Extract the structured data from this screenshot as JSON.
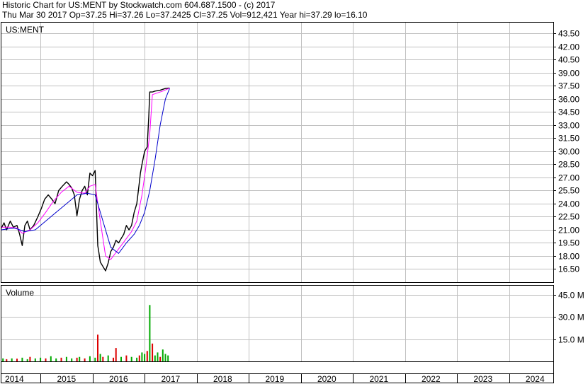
{
  "header": {
    "title_line": "Historic Chart for US:MENT by Stockwatch.com 604.687.1500 - (c) 2017",
    "quote_line": "Thu Mar 30 2017  Op=37.25  Hi=37.26  Lo=37.2425  Cl=37.25  Vol=912,421  Year hi=37.29  lo=16.10"
  },
  "colors": {
    "grid": "#c0c0c0",
    "price_bar": "#000000",
    "ma_short": "#ff00ff",
    "ma_long": "#0000cc",
    "volume_up": "#00aa00",
    "volume_down": "#dd0000"
  },
  "chart_data": [
    {
      "type": "line",
      "title": "US:MENT",
      "y_axis_position": "right",
      "grid": true,
      "y_ticks": [
        "43.50",
        "42.00",
        "40.50",
        "39.00",
        "37.50",
        "36.00",
        "34.50",
        "33.00",
        "31.50",
        "30.00",
        "28.50",
        "27.00",
        "25.50",
        "24.00",
        "22.50",
        "21.00",
        "19.50",
        "18.00",
        "16.50"
      ],
      "ylim": [
        15.0,
        44.75
      ],
      "x_ticks": [
        "2014",
        "2015",
        "2016",
        "2017",
        "2018",
        "2019",
        "2020",
        "2021",
        "2022",
        "2023",
        "2024"
      ],
      "xlim": [
        2013.75,
        2024.35
      ],
      "series": [
        {
          "role": "price",
          "x": [
            2013.75,
            2013.8,
            2013.85,
            2013.92,
            2013.98,
            2014.05,
            2014.1,
            2014.15,
            2014.2,
            2014.25,
            2014.3,
            2014.37,
            2014.45,
            2014.52,
            2014.58,
            2014.65,
            2014.72,
            2014.78,
            2014.85,
            2014.92,
            2015.0,
            2015.05,
            2015.1,
            2015.15,
            2015.2,
            2015.25,
            2015.3,
            2015.35,
            2015.4,
            2015.45,
            2015.5,
            2015.55,
            2015.6,
            2015.62,
            2015.65,
            2015.7,
            2015.75,
            2015.8,
            2015.85,
            2015.9,
            2015.95,
            2016.0,
            2016.05,
            2016.1,
            2016.15,
            2016.2,
            2016.25,
            2016.3,
            2016.35,
            2016.4,
            2016.42,
            2016.45,
            2016.5,
            2016.55,
            2016.58,
            2016.6,
            2016.65,
            2016.7,
            2016.8,
            2016.9,
            2016.98
          ],
          "y": [
            21.2,
            21.8,
            21.0,
            22.0,
            21.3,
            21.5,
            20.5,
            19.2,
            21.5,
            22.0,
            21.0,
            21.5,
            22.5,
            23.5,
            24.5,
            25.0,
            24.5,
            24.0,
            25.5,
            26.0,
            26.5,
            26.2,
            25.8,
            25.0,
            22.6,
            24.5,
            25.5,
            26.0,
            25.0,
            27.5,
            27.2,
            27.8,
            19.2,
            18.5,
            17.3,
            16.8,
            16.3,
            17.2,
            18.5,
            19.0,
            19.8,
            19.5,
            20.0,
            20.5,
            21.5,
            21.0,
            21.5,
            23.0,
            24.0,
            26.5,
            27.5,
            28.5,
            30.0,
            30.5,
            34.0,
            36.8,
            36.8,
            36.9,
            37.0,
            37.2,
            37.25
          ]
        },
        {
          "role": "short moving average",
          "x": [
            2013.75,
            2013.9,
            2014.05,
            2014.15,
            2014.3,
            2014.45,
            2014.6,
            2014.75,
            2014.9,
            2015.05,
            2015.2,
            2015.35,
            2015.45,
            2015.55,
            2015.65,
            2015.75,
            2015.85,
            2016.0,
            2016.15,
            2016.25,
            2016.35,
            2016.45,
            2016.52,
            2016.6,
            2016.65,
            2016.75,
            2016.85,
            2016.98
          ],
          "y": [
            21.3,
            21.3,
            21.2,
            20.6,
            21.0,
            21.8,
            23.0,
            24.3,
            25.3,
            26.0,
            25.3,
            25.2,
            26.0,
            26.2,
            22.0,
            18.0,
            17.6,
            18.8,
            20.0,
            20.8,
            22.0,
            25.0,
            28.0,
            32.0,
            36.5,
            36.7,
            36.9,
            37.25
          ]
        },
        {
          "role": "long moving average",
          "x": [
            2013.75,
            2014.0,
            2014.2,
            2014.4,
            2014.6,
            2014.8,
            2015.0,
            2015.2,
            2015.4,
            2015.55,
            2015.7,
            2015.85,
            2016.0,
            2016.15,
            2016.3,
            2016.4,
            2016.5,
            2016.6,
            2016.7,
            2016.8,
            2016.9,
            2016.98
          ],
          "y": [
            21.0,
            21.2,
            20.8,
            21.0,
            22.0,
            23.0,
            24.0,
            25.0,
            25.2,
            25.0,
            22.0,
            19.0,
            18.3,
            19.5,
            20.5,
            21.5,
            23.0,
            25.5,
            29.0,
            33.0,
            36.0,
            37.2
          ]
        }
      ]
    },
    {
      "type": "bar",
      "title": "Volume",
      "y_axis_position": "right",
      "grid": true,
      "y_ticks": [
        "45.0 M",
        "30.0 M",
        "15.0 M"
      ],
      "ylim": [
        0,
        51
      ],
      "x_ticks": [
        "2014",
        "2015",
        "2016",
        "2017",
        "2018",
        "2019",
        "2020",
        "2021",
        "2022",
        "2023",
        "2024"
      ],
      "xlim": [
        2013.75,
        2024.35
      ],
      "series": [
        {
          "name": "",
          "x": [
            2013.78,
            2013.85,
            2013.95,
            2014.05,
            2014.15,
            2014.25,
            2014.3,
            2014.4,
            2014.5,
            2014.6,
            2014.7,
            2014.8,
            2014.9,
            2015.0,
            2015.1,
            2015.2,
            2015.25,
            2015.35,
            2015.45,
            2015.55,
            2015.6,
            2015.65,
            2015.7,
            2015.8,
            2015.9,
            2015.95,
            2016.05,
            2016.15,
            2016.25,
            2016.35,
            2016.4,
            2016.45,
            2016.5,
            2016.55,
            2016.6,
            2016.65,
            2016.7,
            2016.75,
            2016.8,
            2016.85,
            2016.9,
            2016.95
          ],
          "values": [
            2.0,
            1.5,
            2.0,
            1.8,
            2.5,
            1.5,
            3.0,
            2.0,
            2.5,
            2.0,
            3.5,
            2.0,
            2.5,
            3.0,
            2.0,
            2.5,
            3.0,
            2.0,
            3.5,
            2.5,
            18.0,
            5.0,
            3.0,
            4.0,
            2.5,
            9.0,
            3.0,
            4.0,
            3.0,
            2.5,
            4.0,
            6.0,
            5.0,
            7.0,
            38.0,
            12.0,
            4.0,
            6.0,
            3.0,
            8.0,
            5.0,
            4.0
          ],
          "direction": [
            "up",
            "down",
            "up",
            "down",
            "up",
            "up",
            "down",
            "up",
            "up",
            "down",
            "up",
            "up",
            "down",
            "up",
            "up",
            "down",
            "up",
            "down",
            "up",
            "up",
            "down",
            "up",
            "down",
            "up",
            "down",
            "down",
            "up",
            "down",
            "up",
            "up",
            "down",
            "up",
            "up",
            "down",
            "up",
            "down",
            "up",
            "up",
            "down",
            "up",
            "up",
            "up"
          ]
        }
      ]
    }
  ]
}
